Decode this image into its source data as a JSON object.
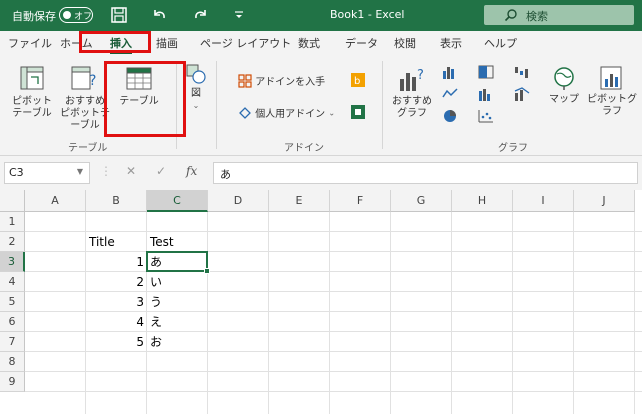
{
  "titlebar": {
    "autosave_label": "自動保存",
    "autosave_state": "オフ",
    "document_title": "Book1  -  Excel",
    "search_placeholder": "検索",
    "colors": {
      "bar": "#217346"
    }
  },
  "menu": {
    "tabs": [
      "ファイル",
      "ホーム",
      "挿入",
      "描画",
      "ページ レイアウト",
      "数式",
      "データ",
      "校閲",
      "表示",
      "ヘルプ"
    ],
    "active_tab": "挿入"
  },
  "ribbon": {
    "groups": {
      "table": {
        "label": "テーブル",
        "pivot_table": "ピボット\nテーブル",
        "recommended_pivot": "おすすめ\nピボットテーブル",
        "table_button": "テーブル"
      },
      "illustrations": {
        "collapsed_label": "図"
      },
      "addins": {
        "label": "アドイン",
        "get_addins": "アドインを入手",
        "my_addins": "個人用アドイン"
      },
      "charts": {
        "label": "グラフ",
        "recommended_charts": "おすすめ\nグラフ",
        "maps": "マップ",
        "pivot_chart": "ピボットグラフ"
      }
    }
  },
  "formula_bar": {
    "name_box": "C3",
    "fx_label": "fx",
    "content": "あ"
  },
  "grid": {
    "columns": [
      "A",
      "B",
      "C",
      "D",
      "E",
      "F",
      "G",
      "H",
      "I",
      "J"
    ],
    "rows": [
      "1",
      "2",
      "3",
      "4",
      "5",
      "6",
      "7",
      "8",
      "9"
    ],
    "selected_column": "C",
    "selected_row": "3",
    "cells": {
      "B2": "Title",
      "C2": "Test",
      "B3": "1",
      "C3": "あ",
      "B4": "2",
      "C4": "い",
      "B5": "3",
      "C5": "う",
      "B6": "4",
      "C6": "え",
      "B7": "5",
      "C7": "お"
    }
  }
}
